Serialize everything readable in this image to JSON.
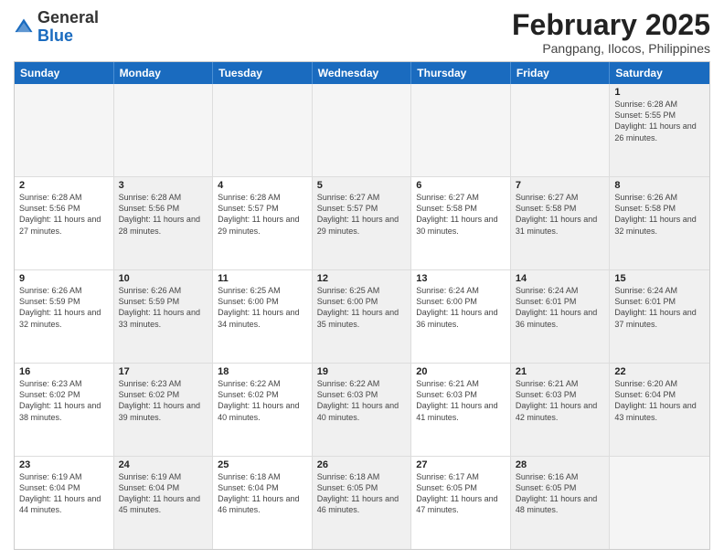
{
  "logo": {
    "general": "General",
    "blue": "Blue"
  },
  "title": {
    "month": "February 2025",
    "location": "Pangpang, Ilocos, Philippines"
  },
  "weekdays": [
    "Sunday",
    "Monday",
    "Tuesday",
    "Wednesday",
    "Thursday",
    "Friday",
    "Saturday"
  ],
  "weeks": [
    [
      {
        "day": "",
        "detail": "",
        "empty": true
      },
      {
        "day": "",
        "detail": "",
        "empty": true
      },
      {
        "day": "",
        "detail": "",
        "empty": true
      },
      {
        "day": "",
        "detail": "",
        "empty": true
      },
      {
        "day": "",
        "detail": "",
        "empty": true
      },
      {
        "day": "",
        "detail": "",
        "empty": true
      },
      {
        "day": "1",
        "detail": "Sunrise: 6:28 AM\nSunset: 5:55 PM\nDaylight: 11 hours\nand 26 minutes.",
        "shaded": true
      }
    ],
    [
      {
        "day": "2",
        "detail": "Sunrise: 6:28 AM\nSunset: 5:56 PM\nDaylight: 11 hours\nand 27 minutes."
      },
      {
        "day": "3",
        "detail": "Sunrise: 6:28 AM\nSunset: 5:56 PM\nDaylight: 11 hours\nand 28 minutes.",
        "shaded": true
      },
      {
        "day": "4",
        "detail": "Sunrise: 6:28 AM\nSunset: 5:57 PM\nDaylight: 11 hours\nand 29 minutes."
      },
      {
        "day": "5",
        "detail": "Sunrise: 6:27 AM\nSunset: 5:57 PM\nDaylight: 11 hours\nand 29 minutes.",
        "shaded": true
      },
      {
        "day": "6",
        "detail": "Sunrise: 6:27 AM\nSunset: 5:58 PM\nDaylight: 11 hours\nand 30 minutes."
      },
      {
        "day": "7",
        "detail": "Sunrise: 6:27 AM\nSunset: 5:58 PM\nDaylight: 11 hours\nand 31 minutes.",
        "shaded": true
      },
      {
        "day": "8",
        "detail": "Sunrise: 6:26 AM\nSunset: 5:58 PM\nDaylight: 11 hours\nand 32 minutes.",
        "shaded": true
      }
    ],
    [
      {
        "day": "9",
        "detail": "Sunrise: 6:26 AM\nSunset: 5:59 PM\nDaylight: 11 hours\nand 32 minutes."
      },
      {
        "day": "10",
        "detail": "Sunrise: 6:26 AM\nSunset: 5:59 PM\nDaylight: 11 hours\nand 33 minutes.",
        "shaded": true
      },
      {
        "day": "11",
        "detail": "Sunrise: 6:25 AM\nSunset: 6:00 PM\nDaylight: 11 hours\nand 34 minutes."
      },
      {
        "day": "12",
        "detail": "Sunrise: 6:25 AM\nSunset: 6:00 PM\nDaylight: 11 hours\nand 35 minutes.",
        "shaded": true
      },
      {
        "day": "13",
        "detail": "Sunrise: 6:24 AM\nSunset: 6:00 PM\nDaylight: 11 hours\nand 36 minutes."
      },
      {
        "day": "14",
        "detail": "Sunrise: 6:24 AM\nSunset: 6:01 PM\nDaylight: 11 hours\nand 36 minutes.",
        "shaded": true
      },
      {
        "day": "15",
        "detail": "Sunrise: 6:24 AM\nSunset: 6:01 PM\nDaylight: 11 hours\nand 37 minutes.",
        "shaded": true
      }
    ],
    [
      {
        "day": "16",
        "detail": "Sunrise: 6:23 AM\nSunset: 6:02 PM\nDaylight: 11 hours\nand 38 minutes."
      },
      {
        "day": "17",
        "detail": "Sunrise: 6:23 AM\nSunset: 6:02 PM\nDaylight: 11 hours\nand 39 minutes.",
        "shaded": true
      },
      {
        "day": "18",
        "detail": "Sunrise: 6:22 AM\nSunset: 6:02 PM\nDaylight: 11 hours\nand 40 minutes."
      },
      {
        "day": "19",
        "detail": "Sunrise: 6:22 AM\nSunset: 6:03 PM\nDaylight: 11 hours\nand 40 minutes.",
        "shaded": true
      },
      {
        "day": "20",
        "detail": "Sunrise: 6:21 AM\nSunset: 6:03 PM\nDaylight: 11 hours\nand 41 minutes."
      },
      {
        "day": "21",
        "detail": "Sunrise: 6:21 AM\nSunset: 6:03 PM\nDaylight: 11 hours\nand 42 minutes.",
        "shaded": true
      },
      {
        "day": "22",
        "detail": "Sunrise: 6:20 AM\nSunset: 6:04 PM\nDaylight: 11 hours\nand 43 minutes.",
        "shaded": true
      }
    ],
    [
      {
        "day": "23",
        "detail": "Sunrise: 6:19 AM\nSunset: 6:04 PM\nDaylight: 11 hours\nand 44 minutes."
      },
      {
        "day": "24",
        "detail": "Sunrise: 6:19 AM\nSunset: 6:04 PM\nDaylight: 11 hours\nand 45 minutes.",
        "shaded": true
      },
      {
        "day": "25",
        "detail": "Sunrise: 6:18 AM\nSunset: 6:04 PM\nDaylight: 11 hours\nand 46 minutes."
      },
      {
        "day": "26",
        "detail": "Sunrise: 6:18 AM\nSunset: 6:05 PM\nDaylight: 11 hours\nand 46 minutes.",
        "shaded": true
      },
      {
        "day": "27",
        "detail": "Sunrise: 6:17 AM\nSunset: 6:05 PM\nDaylight: 11 hours\nand 47 minutes."
      },
      {
        "day": "28",
        "detail": "Sunrise: 6:16 AM\nSunset: 6:05 PM\nDaylight: 11 hours\nand 48 minutes.",
        "shaded": true
      },
      {
        "day": "",
        "detail": "",
        "empty": true
      }
    ]
  ]
}
